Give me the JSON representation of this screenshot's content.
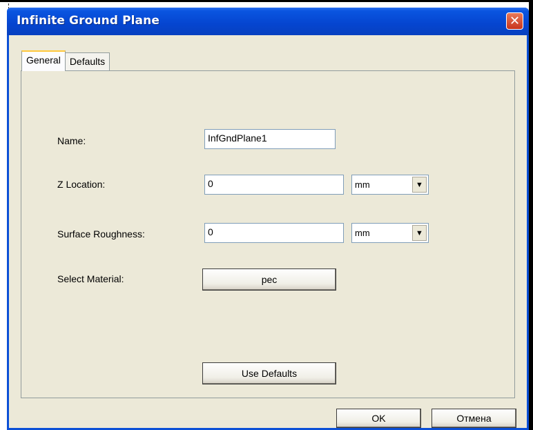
{
  "window": {
    "title": "Infinite Ground Plane",
    "close_glyph": "✕"
  },
  "tabs": [
    {
      "label": "General",
      "active": true
    },
    {
      "label": "Defaults",
      "active": false
    }
  ],
  "form": {
    "name_label": "Name:",
    "name_value": "InfGndPlane1",
    "z_label": "Z Location:",
    "z_value": "0",
    "z_unit": "mm",
    "roughness_label": "Surface Roughness:",
    "roughness_value": "0",
    "roughness_unit": "mm",
    "material_label": "Select Material:",
    "material_value": "pec",
    "use_defaults": "Use Defaults"
  },
  "dialog_buttons": {
    "ok": "OK",
    "cancel": "Отмена"
  },
  "icons": {
    "dropdown": "▼"
  },
  "colors": {
    "titlebar": "#0545d0",
    "close": "#c8341c",
    "dialog_bg": "#ece9d8"
  }
}
